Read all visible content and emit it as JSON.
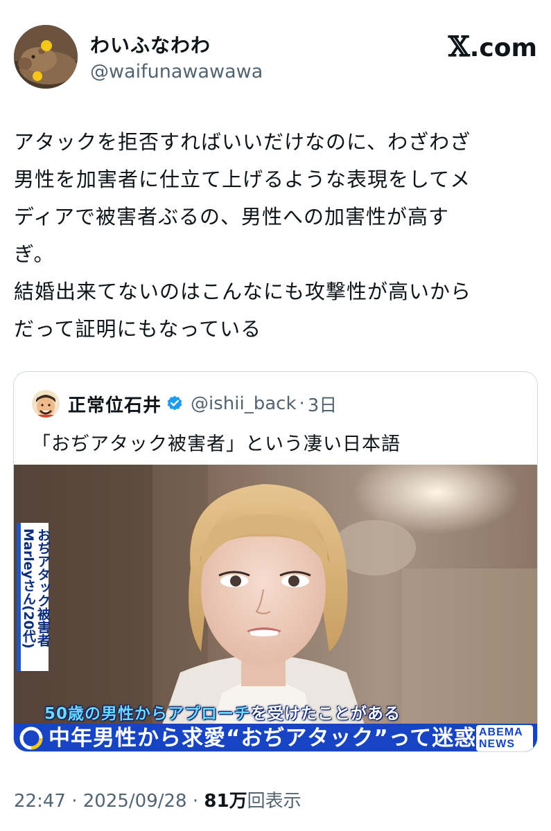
{
  "author": {
    "display_name": "わいふなわわ",
    "handle": "@waifunawawawa"
  },
  "site": {
    "logo_mark": "𝕏",
    "logo_text": ".com"
  },
  "tweet": {
    "lines": [
      "アタックを拒否すればいいだけなのに、わざわざ",
      "男性を加害者に仕立て上げるような表現をしてメ",
      "ディアで被害者ぶるの、男性への加害性が高す",
      "ぎ。",
      "結婚出来てないのはこんなにも攻撃性が高いから",
      "だって証明にもなっている"
    ]
  },
  "quote": {
    "display_name": "正常位石井",
    "verified": true,
    "handle": "@ishii_back",
    "separator": "·",
    "time": "3日",
    "text": "「おぢアタック被害者」という凄い日本語",
    "media": {
      "vertical_caption": {
        "col1": "おぢアタック被害者",
        "col2": "Marleyさん(20代)"
      },
      "subtitle_highlight": "50歳の男性からアプローチ",
      "subtitle_rest": "を受けたことがある",
      "headline": "中年男性から求愛“おぢアタック”って迷惑?",
      "logo_line1": "ABEMA",
      "logo_line2": "NEWS"
    }
  },
  "footer": {
    "time": "22:47",
    "sep1": " · ",
    "date": "2025/09/28",
    "sep2": " · ",
    "views_count": "81万",
    "views_label": "回表示"
  },
  "colors": {
    "accent": "#1d9bf0",
    "muted": "#536471",
    "news_blue": "#1744c4"
  }
}
